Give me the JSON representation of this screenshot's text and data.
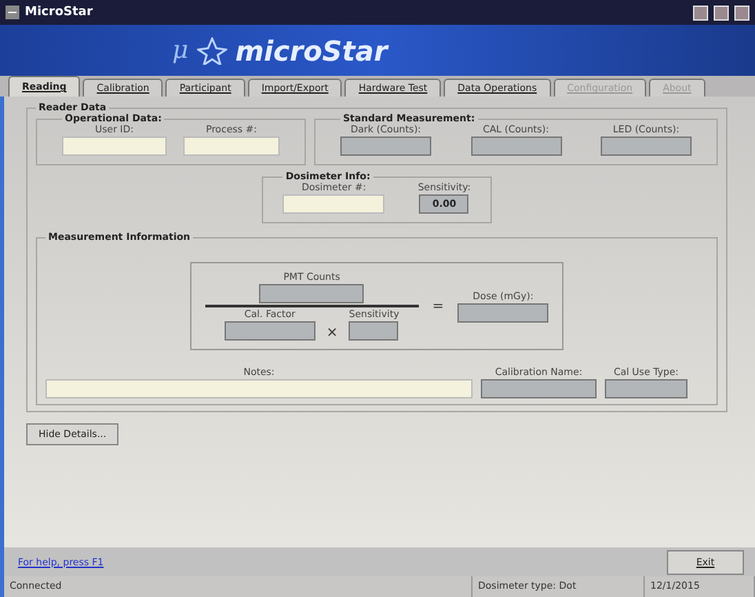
{
  "window": {
    "title": "MicroStar"
  },
  "banner": {
    "symbol": "μ",
    "logo_text": "microStar"
  },
  "tabs": [
    {
      "label": "Reading",
      "selected": true,
      "disabled": false
    },
    {
      "label": "Calibration",
      "selected": false,
      "disabled": false
    },
    {
      "label": "Participant",
      "selected": false,
      "disabled": false
    },
    {
      "label": "Import/Export",
      "selected": false,
      "disabled": false
    },
    {
      "label": "Hardware Test",
      "selected": false,
      "disabled": false
    },
    {
      "label": "Data Operations",
      "selected": false,
      "disabled": false
    },
    {
      "label": "Configuration",
      "selected": false,
      "disabled": true
    },
    {
      "label": "About",
      "selected": false,
      "disabled": true
    }
  ],
  "reader_data": {
    "title": "Reader Data",
    "operational": {
      "title": "Operational Data:",
      "fields": [
        {
          "label": "User ID:",
          "readonly": false
        },
        {
          "label": "Process #:",
          "readonly": false
        }
      ]
    },
    "standard": {
      "title": "Standard Measurement:",
      "fields": [
        {
          "label": "Dark (Counts):",
          "readonly": true
        },
        {
          "label": "CAL (Counts):",
          "readonly": true
        },
        {
          "label": "LED (Counts):",
          "readonly": true
        }
      ]
    },
    "dosimeter": {
      "title": "Dosimeter Info:",
      "fields": [
        {
          "label": "Dosimeter #:",
          "readonly": false
        },
        {
          "label": "Sensitivity:",
          "readonly": true,
          "value": "0.00"
        }
      ]
    },
    "measurement": {
      "title": "Measurement Information",
      "numerator": {
        "label": "PMT Counts",
        "readonly": true
      },
      "factors": [
        {
          "label": "Cal. Factor",
          "readonly": true
        },
        {
          "label": "Sensitivity",
          "readonly": true
        }
      ],
      "times": "×",
      "equals": "=",
      "result": {
        "label": "Dose (mGy):",
        "readonly": true
      },
      "notes": [
        {
          "label": "Notes:",
          "readonly": false
        },
        {
          "label": "Calibration Name:",
          "readonly": true
        },
        {
          "label": "Cal Use Type:",
          "readonly": true
        }
      ]
    }
  },
  "hide_details": "Hide Details...",
  "help_link": "For help, press F1",
  "exit": "Exit",
  "status_bar": [
    "Connected",
    "Dosimeter type: Dot",
    "12/1/2015"
  ]
}
